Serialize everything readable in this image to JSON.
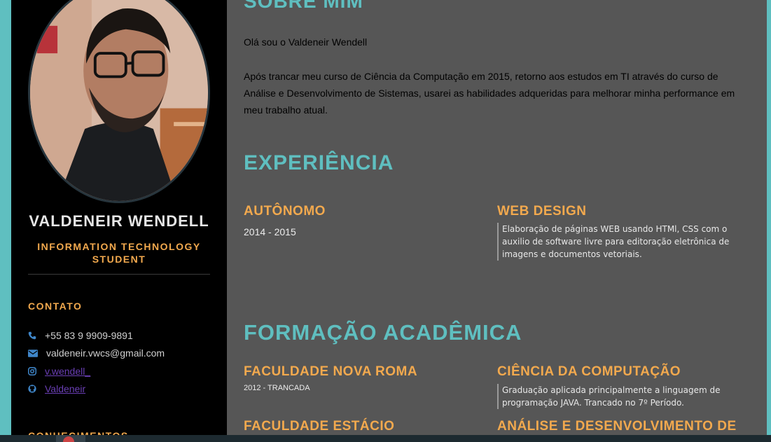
{
  "profile": {
    "name": "VALDENEIR WENDELL",
    "role": "INFORMATION TECHNOLOGY STUDENT"
  },
  "contact": {
    "title": "CONTATO",
    "items": [
      {
        "icon": "phone-icon",
        "text": "+55 83 9 9909-9891",
        "link": false
      },
      {
        "icon": "envelope-icon",
        "text": "valdeneir.vwcs@gmail.com",
        "link": false
      },
      {
        "icon": "instagram-icon",
        "text": "v.wendell_",
        "link": true
      },
      {
        "icon": "github-icon",
        "text": "Valdeneir",
        "link": true
      }
    ]
  },
  "knowledge": {
    "title": "CONHECIMENTOS"
  },
  "about": {
    "title": "SOBRE MIM",
    "greeting": "Olá sou o Valdeneir Wendell",
    "text": "Após trancar meu curso de Ciência da Computação em 2015, retorno aos estudos em TI através do curso de Análise e Desenvolvimento de Sistemas, usarei as habilidades adqueridas para melhorar minha performance em meu trabalho atual."
  },
  "experience": {
    "title": "EXPERIÊNCIA",
    "items": [
      {
        "company": "AUTÔNOMO",
        "period": "2014 - 2015",
        "role": "WEB DESIGN",
        "description": "Elaboração de páginas WEB usando HTMl, CSS com o auxilio de software livre para editoração eletrônica de imagens e documentos vetoriais."
      }
    ]
  },
  "education": {
    "title": "FORMAÇÃO ACADÊMICA",
    "items": [
      {
        "school": "FACULDADE NOVA ROMA",
        "period": "2012 - TRANCADA",
        "course": "CIÊNCIA DA COMPUTAÇÃO",
        "description": "Graduação aplicada principalmente a linguagem de programação JAVA. Trancado no 7º Período."
      },
      {
        "school": "FACULDADE ESTÁCIO",
        "course": "ANÁLISE E DESENVOLVIMENTO DE"
      }
    ]
  },
  "colors": {
    "background": "#5fbfc0",
    "sidebar": "#000000",
    "main": "#565656",
    "accent_teal": "#5fbfc0",
    "accent_orange": "#f2a94e",
    "link": "#6a3fb5"
  }
}
